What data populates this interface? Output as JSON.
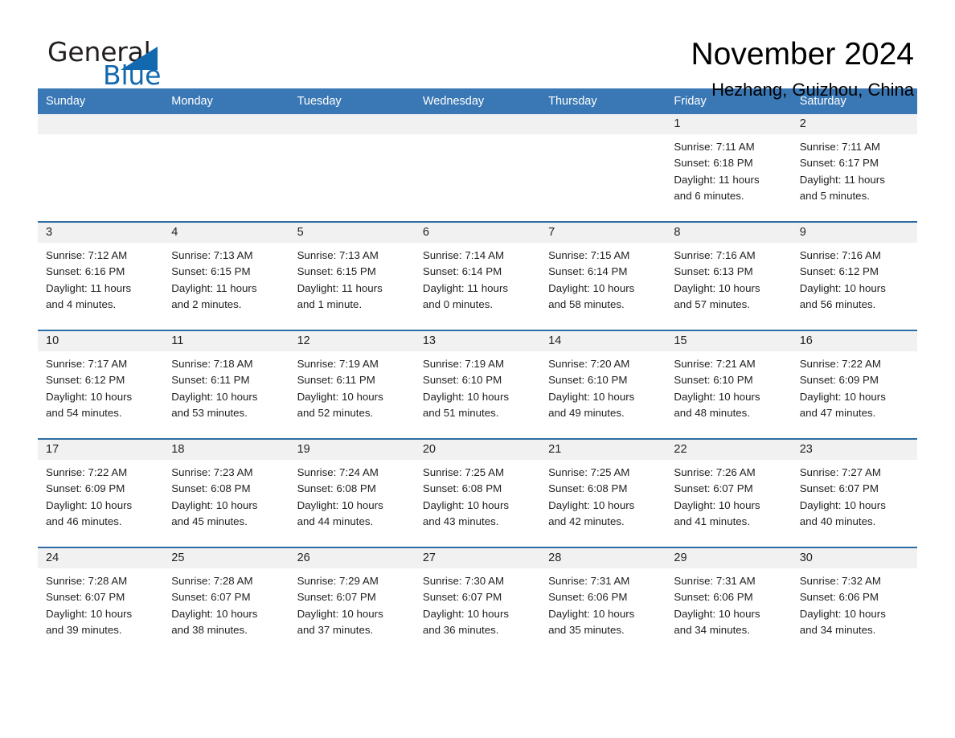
{
  "brand": {
    "word_one": "General",
    "word_two": "Blue",
    "triangle_icon": "triangle-icon",
    "accent_color": "#1369b0"
  },
  "header": {
    "month_title": "November 2024",
    "location": "Hezhang, Guizhou, China"
  },
  "theme": {
    "header_blue": "#3a78b5",
    "row_rule_blue": "#2e6da4",
    "daynum_band": "#f1f1f1",
    "text": "#222222"
  },
  "calendar": {
    "day_headers": [
      "Sunday",
      "Monday",
      "Tuesday",
      "Wednesday",
      "Thursday",
      "Friday",
      "Saturday"
    ],
    "weeks": [
      [
        {
          "day": "",
          "sunrise": "",
          "sunset": "",
          "daylight_line1": "",
          "daylight_line2": "",
          "empty": true
        },
        {
          "day": "",
          "sunrise": "",
          "sunset": "",
          "daylight_line1": "",
          "daylight_line2": "",
          "empty": true
        },
        {
          "day": "",
          "sunrise": "",
          "sunset": "",
          "daylight_line1": "",
          "daylight_line2": "",
          "empty": true
        },
        {
          "day": "",
          "sunrise": "",
          "sunset": "",
          "daylight_line1": "",
          "daylight_line2": "",
          "empty": true
        },
        {
          "day": "",
          "sunrise": "",
          "sunset": "",
          "daylight_line1": "",
          "daylight_line2": "",
          "empty": true
        },
        {
          "day": "1",
          "sunrise": "Sunrise: 7:11 AM",
          "sunset": "Sunset: 6:18 PM",
          "daylight_line1": "Daylight: 11 hours",
          "daylight_line2": "and 6 minutes."
        },
        {
          "day": "2",
          "sunrise": "Sunrise: 7:11 AM",
          "sunset": "Sunset: 6:17 PM",
          "daylight_line1": "Daylight: 11 hours",
          "daylight_line2": "and 5 minutes."
        }
      ],
      [
        {
          "day": "3",
          "sunrise": "Sunrise: 7:12 AM",
          "sunset": "Sunset: 6:16 PM",
          "daylight_line1": "Daylight: 11 hours",
          "daylight_line2": "and 4 minutes."
        },
        {
          "day": "4",
          "sunrise": "Sunrise: 7:13 AM",
          "sunset": "Sunset: 6:15 PM",
          "daylight_line1": "Daylight: 11 hours",
          "daylight_line2": "and 2 minutes."
        },
        {
          "day": "5",
          "sunrise": "Sunrise: 7:13 AM",
          "sunset": "Sunset: 6:15 PM",
          "daylight_line1": "Daylight: 11 hours",
          "daylight_line2": "and 1 minute."
        },
        {
          "day": "6",
          "sunrise": "Sunrise: 7:14 AM",
          "sunset": "Sunset: 6:14 PM",
          "daylight_line1": "Daylight: 11 hours",
          "daylight_line2": "and 0 minutes."
        },
        {
          "day": "7",
          "sunrise": "Sunrise: 7:15 AM",
          "sunset": "Sunset: 6:14 PM",
          "daylight_line1": "Daylight: 10 hours",
          "daylight_line2": "and 58 minutes."
        },
        {
          "day": "8",
          "sunrise": "Sunrise: 7:16 AM",
          "sunset": "Sunset: 6:13 PM",
          "daylight_line1": "Daylight: 10 hours",
          "daylight_line2": "and 57 minutes."
        },
        {
          "day": "9",
          "sunrise": "Sunrise: 7:16 AM",
          "sunset": "Sunset: 6:12 PM",
          "daylight_line1": "Daylight: 10 hours",
          "daylight_line2": "and 56 minutes."
        }
      ],
      [
        {
          "day": "10",
          "sunrise": "Sunrise: 7:17 AM",
          "sunset": "Sunset: 6:12 PM",
          "daylight_line1": "Daylight: 10 hours",
          "daylight_line2": "and 54 minutes."
        },
        {
          "day": "11",
          "sunrise": "Sunrise: 7:18 AM",
          "sunset": "Sunset: 6:11 PM",
          "daylight_line1": "Daylight: 10 hours",
          "daylight_line2": "and 53 minutes."
        },
        {
          "day": "12",
          "sunrise": "Sunrise: 7:19 AM",
          "sunset": "Sunset: 6:11 PM",
          "daylight_line1": "Daylight: 10 hours",
          "daylight_line2": "and 52 minutes."
        },
        {
          "day": "13",
          "sunrise": "Sunrise: 7:19 AM",
          "sunset": "Sunset: 6:10 PM",
          "daylight_line1": "Daylight: 10 hours",
          "daylight_line2": "and 51 minutes."
        },
        {
          "day": "14",
          "sunrise": "Sunrise: 7:20 AM",
          "sunset": "Sunset: 6:10 PM",
          "daylight_line1": "Daylight: 10 hours",
          "daylight_line2": "and 49 minutes."
        },
        {
          "day": "15",
          "sunrise": "Sunrise: 7:21 AM",
          "sunset": "Sunset: 6:10 PM",
          "daylight_line1": "Daylight: 10 hours",
          "daylight_line2": "and 48 minutes."
        },
        {
          "day": "16",
          "sunrise": "Sunrise: 7:22 AM",
          "sunset": "Sunset: 6:09 PM",
          "daylight_line1": "Daylight: 10 hours",
          "daylight_line2": "and 47 minutes."
        }
      ],
      [
        {
          "day": "17",
          "sunrise": "Sunrise: 7:22 AM",
          "sunset": "Sunset: 6:09 PM",
          "daylight_line1": "Daylight: 10 hours",
          "daylight_line2": "and 46 minutes."
        },
        {
          "day": "18",
          "sunrise": "Sunrise: 7:23 AM",
          "sunset": "Sunset: 6:08 PM",
          "daylight_line1": "Daylight: 10 hours",
          "daylight_line2": "and 45 minutes."
        },
        {
          "day": "19",
          "sunrise": "Sunrise: 7:24 AM",
          "sunset": "Sunset: 6:08 PM",
          "daylight_line1": "Daylight: 10 hours",
          "daylight_line2": "and 44 minutes."
        },
        {
          "day": "20",
          "sunrise": "Sunrise: 7:25 AM",
          "sunset": "Sunset: 6:08 PM",
          "daylight_line1": "Daylight: 10 hours",
          "daylight_line2": "and 43 minutes."
        },
        {
          "day": "21",
          "sunrise": "Sunrise: 7:25 AM",
          "sunset": "Sunset: 6:08 PM",
          "daylight_line1": "Daylight: 10 hours",
          "daylight_line2": "and 42 minutes."
        },
        {
          "day": "22",
          "sunrise": "Sunrise: 7:26 AM",
          "sunset": "Sunset: 6:07 PM",
          "daylight_line1": "Daylight: 10 hours",
          "daylight_line2": "and 41 minutes."
        },
        {
          "day": "23",
          "sunrise": "Sunrise: 7:27 AM",
          "sunset": "Sunset: 6:07 PM",
          "daylight_line1": "Daylight: 10 hours",
          "daylight_line2": "and 40 minutes."
        }
      ],
      [
        {
          "day": "24",
          "sunrise": "Sunrise: 7:28 AM",
          "sunset": "Sunset: 6:07 PM",
          "daylight_line1": "Daylight: 10 hours",
          "daylight_line2": "and 39 minutes."
        },
        {
          "day": "25",
          "sunrise": "Sunrise: 7:28 AM",
          "sunset": "Sunset: 6:07 PM",
          "daylight_line1": "Daylight: 10 hours",
          "daylight_line2": "and 38 minutes."
        },
        {
          "day": "26",
          "sunrise": "Sunrise: 7:29 AM",
          "sunset": "Sunset: 6:07 PM",
          "daylight_line1": "Daylight: 10 hours",
          "daylight_line2": "and 37 minutes."
        },
        {
          "day": "27",
          "sunrise": "Sunrise: 7:30 AM",
          "sunset": "Sunset: 6:07 PM",
          "daylight_line1": "Daylight: 10 hours",
          "daylight_line2": "and 36 minutes."
        },
        {
          "day": "28",
          "sunrise": "Sunrise: 7:31 AM",
          "sunset": "Sunset: 6:06 PM",
          "daylight_line1": "Daylight: 10 hours",
          "daylight_line2": "and 35 minutes."
        },
        {
          "day": "29",
          "sunrise": "Sunrise: 7:31 AM",
          "sunset": "Sunset: 6:06 PM",
          "daylight_line1": "Daylight: 10 hours",
          "daylight_line2": "and 34 minutes."
        },
        {
          "day": "30",
          "sunrise": "Sunrise: 7:32 AM",
          "sunset": "Sunset: 6:06 PM",
          "daylight_line1": "Daylight: 10 hours",
          "daylight_line2": "and 34 minutes."
        }
      ]
    ]
  }
}
